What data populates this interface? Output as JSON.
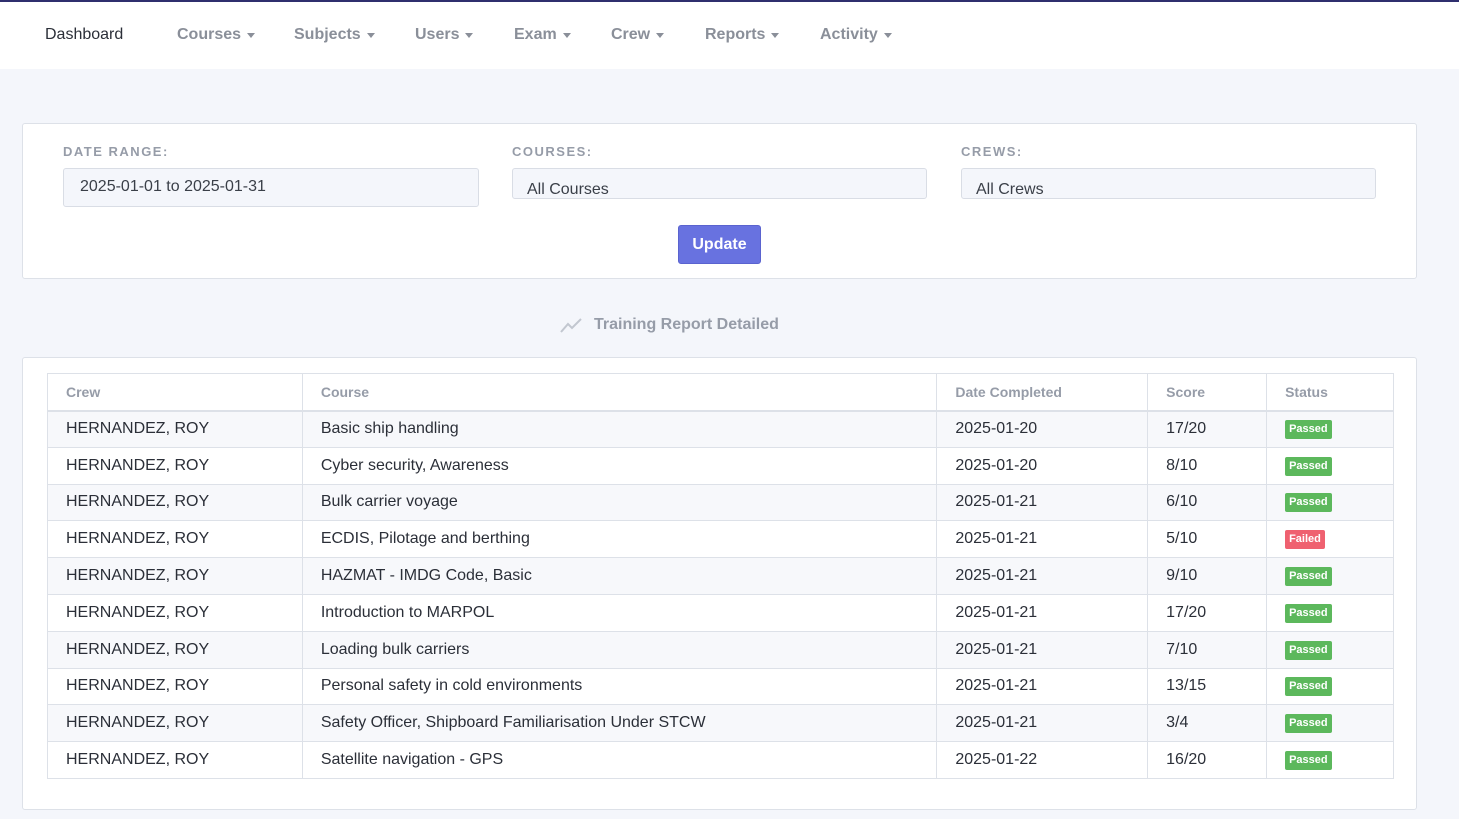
{
  "nav": {
    "dashboard": "Dashboard",
    "courses": "Courses",
    "subjects": "Subjects",
    "users": "Users",
    "exam": "Exam",
    "crew": "Crew",
    "reports": "Reports",
    "activity": "Activity"
  },
  "filters": {
    "date_range_label": "DATE RANGE:",
    "date_range_value": "2025-01-01 to 2025-01-31",
    "courses_label": "COURSES:",
    "courses_value": "All Courses",
    "crews_label": "CREWS:",
    "crews_value": "All Crews",
    "update_label": "Update"
  },
  "report": {
    "title": "Training Report Detailed",
    "icon": "chart-line-icon",
    "columns": [
      "Crew",
      "Course",
      "Date Completed",
      "Score",
      "Status"
    ],
    "rows": [
      {
        "crew": "HERNANDEZ, ROY",
        "course": "Basic ship handling",
        "date": "2025-01-20",
        "score": "17/20",
        "status": "Passed"
      },
      {
        "crew": "HERNANDEZ, ROY",
        "course": "Cyber security, Awareness",
        "date": "2025-01-20",
        "score": "8/10",
        "status": "Passed"
      },
      {
        "crew": "HERNANDEZ, ROY",
        "course": "Bulk carrier voyage",
        "date": "2025-01-21",
        "score": "6/10",
        "status": "Passed"
      },
      {
        "crew": "HERNANDEZ, ROY",
        "course": "ECDIS, Pilotage and berthing",
        "date": "2025-01-21",
        "score": "5/10",
        "status": "Failed"
      },
      {
        "crew": "HERNANDEZ, ROY",
        "course": "HAZMAT - IMDG Code, Basic",
        "date": "2025-01-21",
        "score": "9/10",
        "status": "Passed"
      },
      {
        "crew": "HERNANDEZ, ROY",
        "course": "Introduction to MARPOL",
        "date": "2025-01-21",
        "score": "17/20",
        "status": "Passed"
      },
      {
        "crew": "HERNANDEZ, ROY",
        "course": "Loading bulk carriers",
        "date": "2025-01-21",
        "score": "7/10",
        "status": "Passed"
      },
      {
        "crew": "HERNANDEZ, ROY",
        "course": "Personal safety in cold environments",
        "date": "2025-01-21",
        "score": "13/15",
        "status": "Passed"
      },
      {
        "crew": "HERNANDEZ, ROY",
        "course": "Safety Officer, Shipboard Familiarisation Under STCW",
        "date": "2025-01-21",
        "score": "3/4",
        "status": "Passed"
      },
      {
        "crew": "HERNANDEZ, ROY",
        "course": "Satellite navigation - GPS",
        "date": "2025-01-22",
        "score": "16/20",
        "status": "Passed"
      }
    ]
  },
  "colors": {
    "accent": "#6872e0",
    "passed": "#5cb85c",
    "failed": "#ef6170"
  }
}
